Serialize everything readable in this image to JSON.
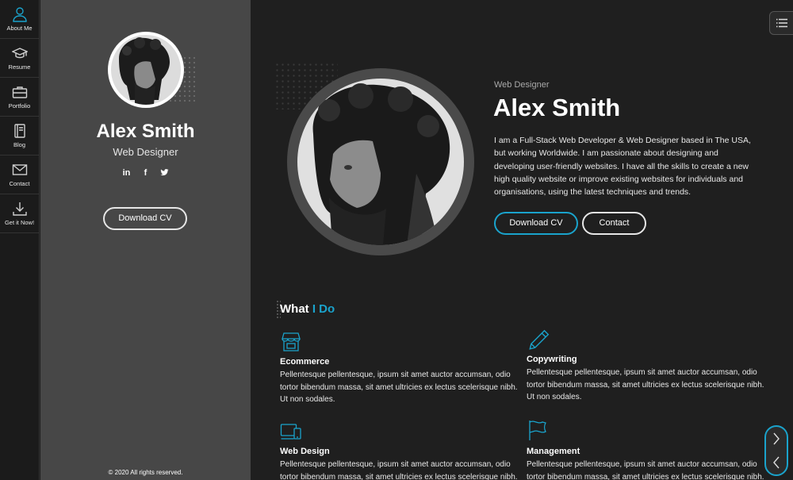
{
  "nav": {
    "items": [
      {
        "label": "About Me",
        "icon": "person-icon"
      },
      {
        "label": "Resume",
        "icon": "graduation-cap-icon"
      },
      {
        "label": "Portfolio",
        "icon": "briefcase-icon"
      },
      {
        "label": "Blog",
        "icon": "book-icon"
      },
      {
        "label": "Contact",
        "icon": "envelope-icon"
      },
      {
        "label": "Get it Now!",
        "icon": "download-icon"
      }
    ]
  },
  "profile": {
    "name": "Alex Smith",
    "role": "Web Designer",
    "social": [
      "in",
      "f",
      "t"
    ],
    "download_label": "Download CV",
    "footer": "© 2020 All rights reserved."
  },
  "hero": {
    "role": "Web Designer",
    "name": "Alex Smith",
    "bio": "I am a Full-Stack Web Developer & Web Designer based in The USA, but working Worldwide. I am passionate about designing and developing user-friendly websites. I have all the skills to create a new high quality website or improve existing websites for individuals and organisations, using the latest techniques and trends.",
    "download_label": "Download CV",
    "contact_label": "Contact"
  },
  "what_i_do": {
    "title_part1": "What",
    "title_part2": "I Do",
    "services": [
      {
        "title": "Ecommerce",
        "icon": "shop-icon",
        "desc": "Pellentesque pellentesque, ipsum sit amet auctor accumsan, odio tortor bibendum massa, sit amet ultricies ex lectus scelerisque nibh. Ut non sodales."
      },
      {
        "title": "Copywriting",
        "icon": "pencil-icon",
        "desc": "Pellentesque pellentesque, ipsum sit amet auctor accumsan, odio tortor bibendum massa, sit amet ultricies ex lectus scelerisque nibh. Ut non sodales."
      },
      {
        "title": "Web Design",
        "icon": "devices-icon",
        "desc": "Pellentesque pellentesque, ipsum sit amet auctor accumsan, odio tortor bibendum massa, sit amet ultricies ex lectus scelerisque nibh. Ut non sodales."
      },
      {
        "title": "Management",
        "icon": "flag-icon",
        "desc": "Pellentesque pellentesque, ipsum sit amet auctor accumsan, odio tortor bibendum massa, sit amet ultricies ex lectus scelerisque nibh. Ut non sodales."
      }
    ]
  },
  "colors": {
    "accent": "#1aa3cc",
    "panel": "#474747",
    "background": "#1f1f1f"
  }
}
